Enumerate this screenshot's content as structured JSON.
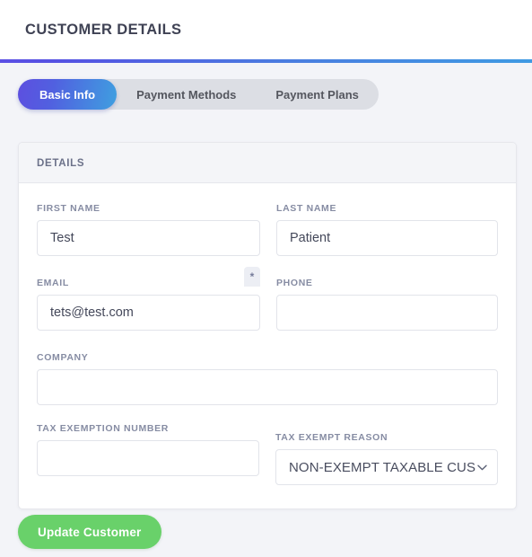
{
  "header": {
    "title": "CUSTOMER DETAILS",
    "accent_start_color": "#5b4fe4",
    "accent_end_color": "#3f9ae3"
  },
  "tabs": [
    {
      "label": "Basic Info",
      "active": true
    },
    {
      "label": "Payment Methods",
      "active": false
    },
    {
      "label": "Payment Plans",
      "active": false
    }
  ],
  "panel": {
    "header_title": "DETAILS"
  },
  "form": {
    "first_name": {
      "label": "FIRST NAME",
      "value": "Test",
      "placeholder": ""
    },
    "last_name": {
      "label": "LAST NAME",
      "value": "Patient",
      "placeholder": ""
    },
    "email": {
      "label": "EMAIL",
      "value": "tets@test.com",
      "placeholder": "",
      "required_marker": "*"
    },
    "phone": {
      "label": "PHONE",
      "value": "",
      "placeholder": ""
    },
    "company": {
      "label": "COMPANY",
      "value": "",
      "placeholder": ""
    },
    "tax_exemption_number": {
      "label": "TAX EXEMPTION NUMBER",
      "value": "",
      "placeholder": ""
    },
    "tax_exempt_reason": {
      "label": "TAX EXEMPT REASON",
      "selected": "NON-EXEMPT TAXABLE CUS",
      "chevron_icon": "chevron-down-icon"
    }
  },
  "actions": {
    "update_customer_label": "Update Customer",
    "update_customer_color": "#69d16a"
  }
}
